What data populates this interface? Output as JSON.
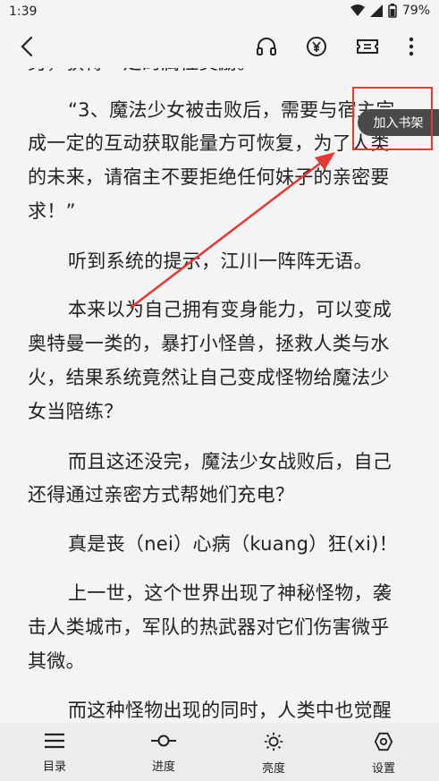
{
  "status": {
    "time": "1:39",
    "battery": "79%"
  },
  "toolbar": {
    "back_icon": "back-arrow-icon",
    "listen_icon": "headphones-icon",
    "reward_icon": "yuan-coin-icon",
    "ticket_icon": "ticket-icon",
    "more_icon": "more-vertical-icon"
  },
  "reader": {
    "partial_line": "另，获得一定的属性奖励。",
    "lines": [
      "“3、魔法少女被击败后，需要与宿主完",
      "成一定的互动获取能量方可恢复，为了人类",
      "的未来，请宿主不要拒绝任何妹子的亲密要",
      "求！”",
      "听到系统的提示，江川一阵阵无语。",
      "本来以为自己拥有变身能力，可以变成",
      "奥特曼一类的，暴打小怪兽，拯救人类与水",
      "火，结果系统竟然让自己变成怪物给魔法少",
      "女当陪练？",
      "而且这还没完，魔法少女战败后，自己",
      "还得通过亲密方式帮她们充电？",
      "真是丧（nei）心病（kuang）狂(xi)！",
      "上一世，这个世界出现了神秘怪物，袭",
      "击人类城市，军队的热武器对它们伤害微乎",
      "其微。",
      "而这种怪物出现的同时，人类中也觉醒"
    ]
  },
  "bookshelf_button": {
    "label": "加入书架"
  },
  "bottom_bar": {
    "items": [
      {
        "label": "目录",
        "icon": "menu-list-icon"
      },
      {
        "label": "进度",
        "icon": "progress-slider-icon"
      },
      {
        "label": "亮度",
        "icon": "brightness-sun-icon"
      },
      {
        "label": "设置",
        "icon": "settings-gear-icon"
      }
    ]
  },
  "colors": {
    "background": "#f4f4f4",
    "bottom_bar": "#ececec",
    "pill": "#4a4a4a",
    "annotation": "#e53935"
  }
}
